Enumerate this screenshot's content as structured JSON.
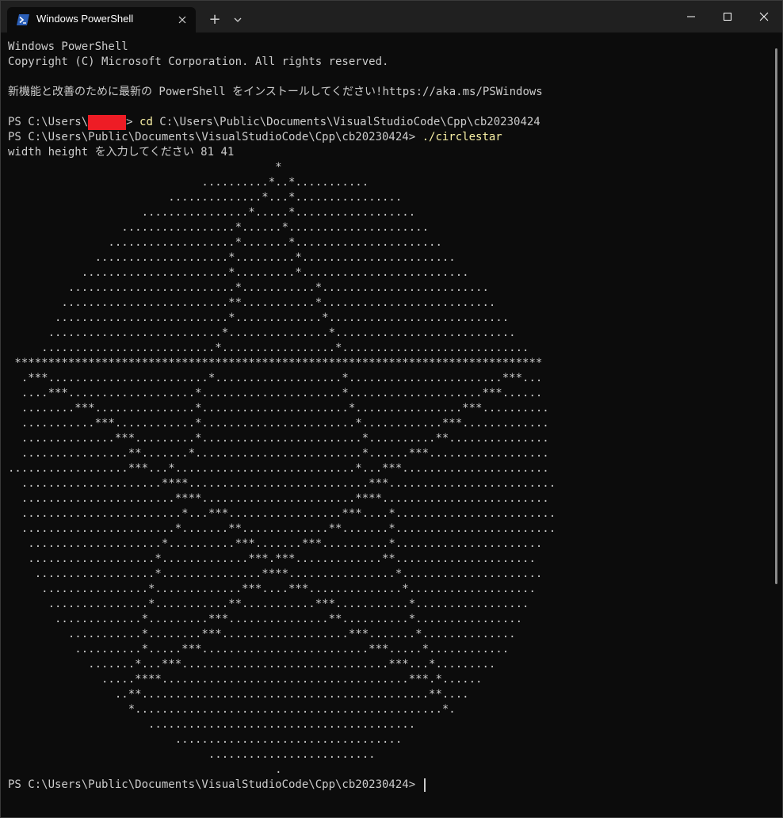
{
  "window": {
    "tab_title": "Windows PowerShell",
    "new_tab_label": "+"
  },
  "console": {
    "header1": "Windows PowerShell",
    "header2": "Copyright (C) Microsoft Corporation. All rights reserved.",
    "blank": "",
    "notice": "新機能と改善のために最新の PowerShell をインストールしてください!https://aka.ms/PSWindows",
    "cmd1": {
      "prompt_start": "PS C:\\Users\\",
      "prompt_end": "> ",
      "command": "cd",
      "args": " C:\\Users\\Public\\Documents\\VisualStudioCode\\Cpp\\cb20230424"
    },
    "cmd2": {
      "prompt": "PS C:\\Users\\Public\\Documents\\VisualStudioCode\\Cpp\\cb20230424> ",
      "command": "./circlestar"
    },
    "program_prompt": "width height を入力してください 81 41",
    "art": [
      "                                        *",
      "                             ..........*..*...........",
      "                        ..............*...*................",
      "                    ................*.....*..................",
      "                 .................*......*.....................",
      "               ...................*.......*......................",
      "             ....................*.........*.......................",
      "           ......................*.........*.........................",
      "         .........................*...........*.........................",
      "        .........................**...........*..........................",
      "       ..........................*.............*...........................",
      "      ..........................*...............*...........................",
      "     ..........................*.................*............................",
      " *******************************************************************************",
      "  .***........................*...................*.......................***...",
      "  ....***...................*.....................*....................***......",
      "  ........***...............*......................*................***..........",
      "  ...........***............*.......................*............***.............",
      "  ..............***.........*........................*..........**...............",
      "  ................**.......*.........................*......***..................",
      "..................***...*...........................*...***......................",
      "  .....................****...........................***.........................",
      "  .......................****.......................****.........................",
      "  ........................*...***.................***....*........................",
      "  .......................*.......**.............**.......*........................",
      "   ....................*..........***.......***..........*......................",
      "   ...................*.............***.***.............**.....................",
      "    ..................*...............****................*.....................",
      "     ................*.............***....***..............*...................",
      "      ...............*...........**...........***...........*.................",
      "       .............*.........***...............**..........*................",
      "         ...........*........***...................***.......*..............",
      "          ..........*.....***.........................***.....*............",
      "            .......*...***...............................***...*.........",
      "              .....****.....................................***.*......",
      "                ..**...........................................**....",
      "                  *..............................................*.",
      "                     ........................................",
      "                         ..................................",
      "                              .........................",
      "                                        ."
    ],
    "final_prompt": "PS C:\\Users\\Public\\Documents\\VisualStudioCode\\Cpp\\cb20230424> "
  }
}
